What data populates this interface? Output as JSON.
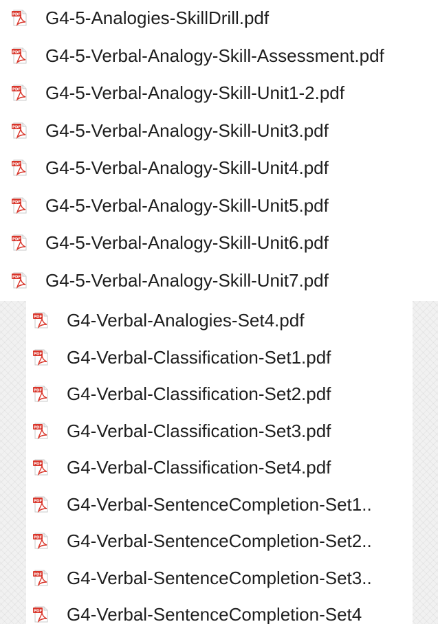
{
  "top_list": {
    "icon": "pdf-file-icon",
    "files": [
      "G4-5-Analogies-SkillDrill.pdf",
      "G4-5-Verbal-Analogy-Skill-Assessment.pdf",
      "G4-5-Verbal-Analogy-Skill-Unit1-2.pdf",
      "G4-5-Verbal-Analogy-Skill-Unit3.pdf",
      "G4-5-Verbal-Analogy-Skill-Unit4.pdf",
      "G4-5-Verbal-Analogy-Skill-Unit5.pdf",
      "G4-5-Verbal-Analogy-Skill-Unit6.pdf",
      "G4-5-Verbal-Analogy-Skill-Unit7.pdf"
    ]
  },
  "bottom_list": {
    "icon": "pdf-file-icon",
    "files": [
      "G4-Verbal-Analogies-Set4.pdf",
      "G4-Verbal-Classification-Set1.pdf",
      "G4-Verbal-Classification-Set2.pdf",
      "G4-Verbal-Classification-Set3.pdf",
      "G4-Verbal-Classification-Set4.pdf",
      "G4-Verbal-SentenceCompletion-Set1..",
      "G4-Verbal-SentenceCompletion-Set2..",
      "G4-Verbal-SentenceCompletion-Set3..",
      "G4-Verbal-SentenceCompletion-Set4"
    ]
  },
  "colors": {
    "pdf_badge": "#d9352a",
    "acrobat_symbol": "#d9352a",
    "text": "#1e1e1e"
  }
}
